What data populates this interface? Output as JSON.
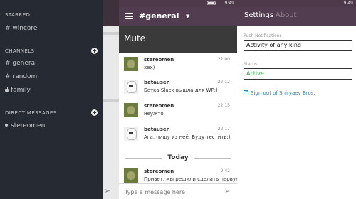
{
  "sidebar": {
    "sections": {
      "starred": "STARRED",
      "channels": "CHANNELS",
      "direct_messages": "DIRECT MESSAGES"
    },
    "starred_items": [
      "# wincore"
    ],
    "channels": [
      "# general",
      "# random",
      "family"
    ],
    "direct_messages": [
      "stereomen"
    ]
  },
  "channel": {
    "status_time": "9:49",
    "title": "#general",
    "mute_label": "Mute",
    "messages": [
      {
        "author": "stereomen",
        "time": "22:00",
        "text": "хех)"
      },
      {
        "author": "betauser",
        "time": "22:12",
        "text": "Бетка Slack вышла для WP:)"
      },
      {
        "author": "stereomen",
        "time": "22:15",
        "text": "неужто"
      },
      {
        "author": "betauser",
        "time": "22:17",
        "text": "Ага, пишу из неё. Буду тестить:)"
      },
      {
        "author": "stereomen",
        "time": "9:42",
        "text": "Привет, мы решили сделать первую"
      }
    ],
    "divider": "Today",
    "compose_placeholder": "Type a message here"
  },
  "settings": {
    "status_time": "9:49",
    "tabs": [
      "Settings",
      "About"
    ],
    "push_label": "Push Notifications",
    "push_value": "Activity of any kind",
    "status_label": "Status",
    "status_value": "Active",
    "signout_link": "Sign out of Shiryaev Bros."
  },
  "colors": {
    "sidebar_bg": "#262b33",
    "header_bg": "#523c4f",
    "mute_bg": "#3a3a3a",
    "status_active": "#3aa64c",
    "link": "#2a80b9"
  }
}
